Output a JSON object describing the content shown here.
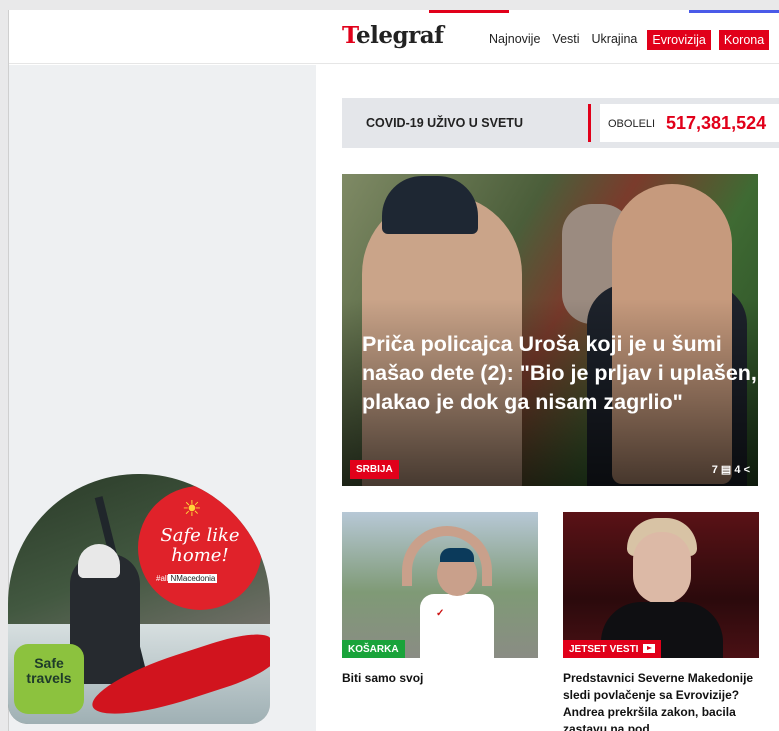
{
  "header": {
    "logo": "Telegraf",
    "nav": [
      "Najnovije",
      "Vesti",
      "Ukrajina",
      "Evrovizija",
      "Korona"
    ]
  },
  "covid": {
    "label": "COVID-19 UŽIVO U SVETU",
    "obolelilabel": "OBOLELI",
    "obolelivalue": "517,381,524"
  },
  "hero": {
    "title": "Priča policajca Uroša koji je u šumi našao dete (2): \"Bio je prljav i uplašen, plakao je dok ga nisam zagrlio\"",
    "tag": "SRBIJA",
    "comments": "7",
    "shares": "4"
  },
  "cards": [
    {
      "tag": "KOŠARKA",
      "title": "Biti samo svoj"
    },
    {
      "tag": "JETSET VESTI",
      "title": "Predstavnici Severne Makedonije sledi povlačenje sa Evrovizije? Andrea prekršila zakon, bacila zastavu na pod"
    }
  ],
  "ad": {
    "slogan": "Safe like home!",
    "hashtag_prefix": "#all",
    "hashtag": "NMacedonia",
    "badge": "Safe travels"
  }
}
